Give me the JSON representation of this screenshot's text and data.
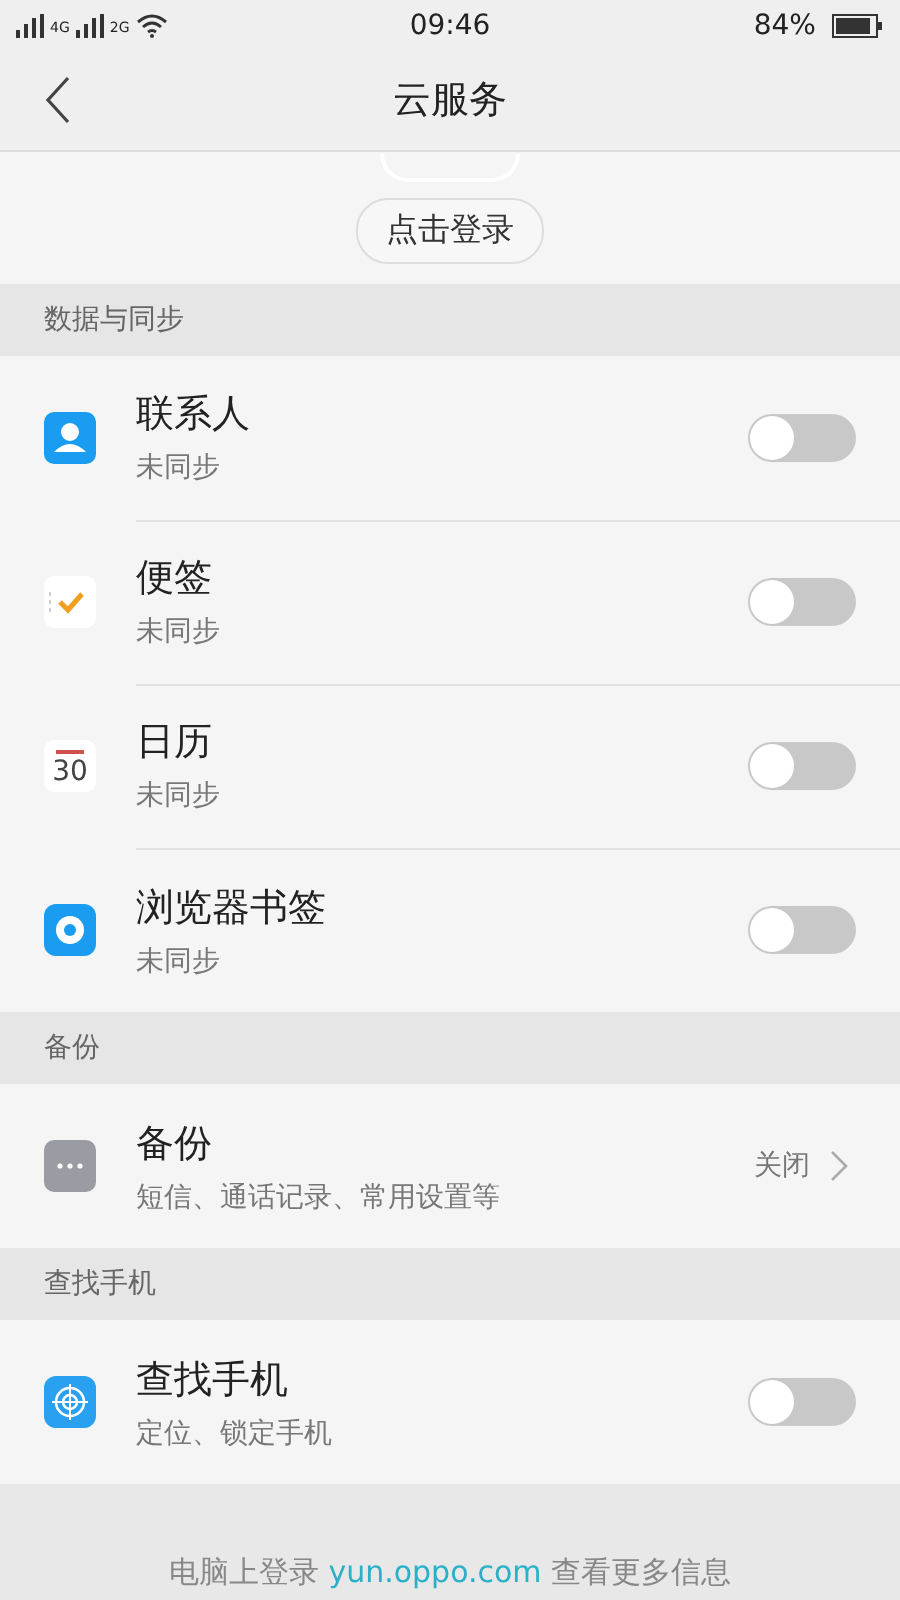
{
  "status_bar": {
    "network_1": "4G",
    "network_2": "2G",
    "time": "09:46",
    "battery": "84%"
  },
  "header": {
    "title": "云服务"
  },
  "account": {
    "login_button": "点击登录"
  },
  "sections": [
    {
      "title": "数据与同步",
      "items": [
        {
          "kind": "toggle",
          "title": "联系人",
          "subtitle": "未同步",
          "on": false
        },
        {
          "kind": "toggle",
          "title": "便签",
          "subtitle": "未同步",
          "on": false
        },
        {
          "kind": "toggle",
          "icon_text": "30",
          "title": "日历",
          "subtitle": "未同步",
          "on": false
        },
        {
          "kind": "toggle",
          "title": "浏览器书签",
          "subtitle": "未同步",
          "on": false
        }
      ]
    },
    {
      "title": "备份",
      "items": [
        {
          "kind": "link",
          "title": "备份",
          "subtitle": "短信、通话记录、常用设置等",
          "value": "关闭"
        }
      ]
    },
    {
      "title": "查找手机",
      "items": [
        {
          "kind": "toggle",
          "title": "查找手机",
          "subtitle": "定位、锁定手机",
          "on": false
        }
      ]
    }
  ],
  "footer": {
    "text": "电脑上登录",
    "link": "yun.oppo.com",
    "after": "查看更多信息"
  }
}
